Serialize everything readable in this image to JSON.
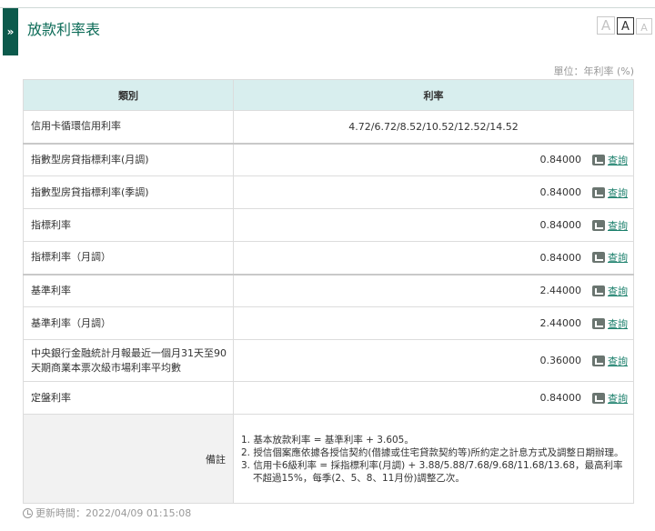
{
  "header": {
    "toggle_glyph": "»",
    "title": "放款利率表",
    "font_sizes": {
      "large": "A",
      "medium": "A",
      "small": "A"
    }
  },
  "unit_note": "單位：年利率 (%)",
  "table": {
    "headers": {
      "category": "類別",
      "rate": "利率"
    },
    "query_label": "查詢",
    "rows": [
      {
        "name": "信用卡循環信用利率",
        "rate": "4.72/6.72/8.52/10.52/12.52/14.52"
      },
      {
        "name": "指數型房貸指標利率(月調)",
        "rate": "0.84000"
      },
      {
        "name": "指數型房貸指標利率(季調)",
        "rate": "0.84000"
      },
      {
        "name": "指標利率",
        "rate": "0.84000"
      },
      {
        "name": "指標利率（月調）",
        "rate": "0.84000"
      },
      {
        "name": "基準利率",
        "rate": "2.44000"
      },
      {
        "name": "基準利率（月調）",
        "rate": "2.44000"
      },
      {
        "name": "中央銀行金融統計月報最近一個月31天至90天期商業本票次級市場利率平均數",
        "rate": "0.36000"
      },
      {
        "name": "定盤利率",
        "rate": "0.84000"
      }
    ],
    "notes_label": "備註",
    "notes": [
      "1. 基本放款利率 = 基準利率 + 3.605。",
      "2. 授信個案應依據各授信契約(借據或住宅貸款契約等)所約定之計息方式及調整日期辦理。",
      "3. 信用卡6級利率 = 採指標利率(月調) + 3.88/5.88/7.68/9.68/11.68/13.68，最高利率不超過15%，每季(2、5、8、11月份)調整乙次。"
    ]
  },
  "update": {
    "label": "更新時間：2022/04/09 01:15:08"
  },
  "colors": {
    "accent": "#0c5a4c",
    "header_bg": "#d8eeee",
    "link": "#1a7f6b"
  }
}
